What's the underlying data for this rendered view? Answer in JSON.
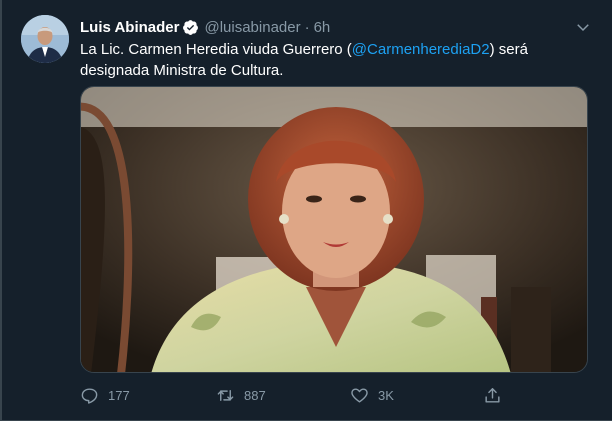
{
  "tweet": {
    "author_name": "Luis Abinader",
    "handle": "@luisabinader",
    "separator": "·",
    "time": "6h",
    "text_before": "La Lic. Carmen Heredia viuda Guerrero (",
    "mention": "@CarmenherediaD2",
    "text_after": ") será designada Ministra de Cultura.",
    "replies": "177",
    "retweets": "887",
    "likes": "3K"
  },
  "icons": {
    "verified": "verified-badge-icon",
    "more": "chevron-down-icon",
    "reply": "reply-icon",
    "retweet": "retweet-icon",
    "like": "heart-icon",
    "share": "share-icon"
  },
  "colors": {
    "background": "#15202b",
    "text": "#ffffff",
    "muted": "#8899a6",
    "accent": "#1da1f2",
    "border": "#38444d"
  }
}
